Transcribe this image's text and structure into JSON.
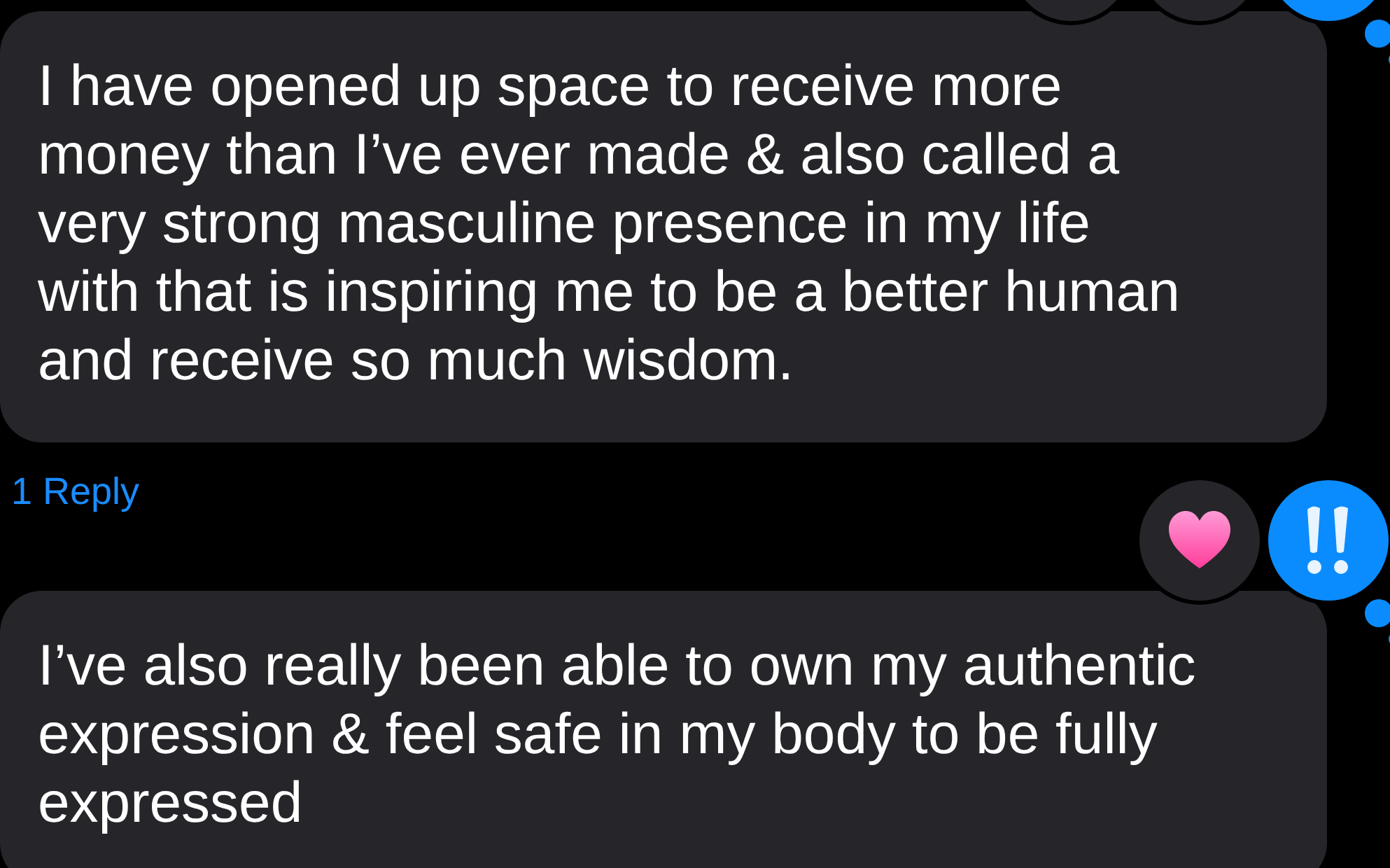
{
  "messages": [
    {
      "text": "I have opened up space to receive more money than I’ve ever made & also called a very strong masculine presence in my life with that is inspiring me to be a better human and receive so much wisdom.",
      "reactions": [
        {
          "kind": "hidden",
          "mine": false
        },
        {
          "kind": "hidden",
          "mine": false
        },
        {
          "kind": "hidden",
          "mine": true
        }
      ],
      "reply_link": "1 Reply"
    },
    {
      "text": "I’ve also really been able to own my authentic expression & feel safe in my body to be fully expressed",
      "reactions": [
        {
          "kind": "heart",
          "mine": false
        },
        {
          "kind": "exclaim",
          "mine": true
        }
      ]
    }
  ]
}
